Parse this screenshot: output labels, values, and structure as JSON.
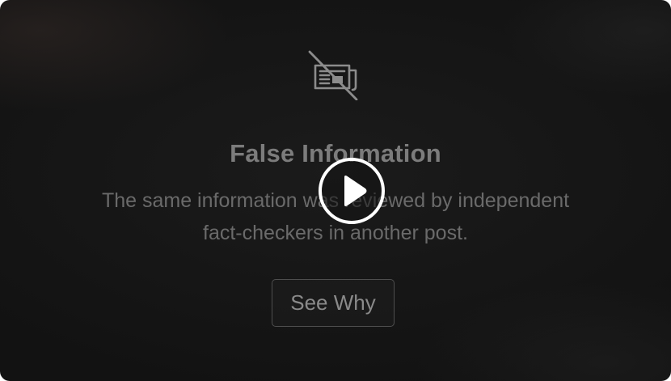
{
  "overlay": {
    "icon": "newspaper-crossed-out-icon",
    "title": "False Information",
    "description": "The same information was reviewed by independent fact-checkers in another post.",
    "button_label": "See Why"
  },
  "player": {
    "play_icon": "play-icon"
  },
  "colors": {
    "background": "#141414",
    "title_text": "#7c7c7c",
    "body_text": "#6a6a6a",
    "play_ring": "#ffffff"
  }
}
